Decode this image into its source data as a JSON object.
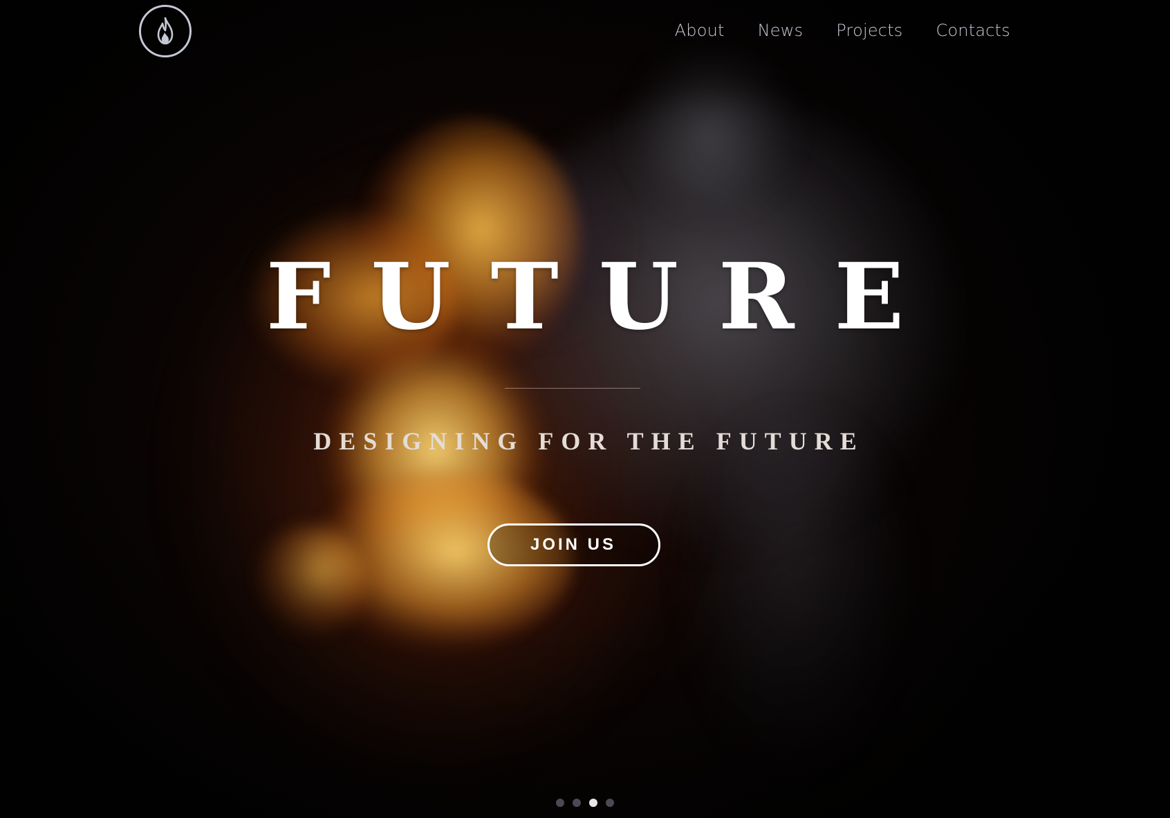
{
  "brand": {
    "logo_icon": "flame-icon",
    "logo_color": "#c5c8d4"
  },
  "nav": {
    "items": [
      {
        "label": "About"
      },
      {
        "label": "News"
      },
      {
        "label": "Projects"
      },
      {
        "label": "Contacts"
      }
    ],
    "link_color": "#c8cad6"
  },
  "hero": {
    "title": "FUTURE",
    "subtitle": "DESIGNING FOR THE FUTURE",
    "cta_label": "JOIN US",
    "background": "fire-and-smoke-burst"
  },
  "slider": {
    "total": 4,
    "active_index": 2,
    "active_color": "#e6e6ea",
    "inactive_color": "#4a4a52"
  }
}
